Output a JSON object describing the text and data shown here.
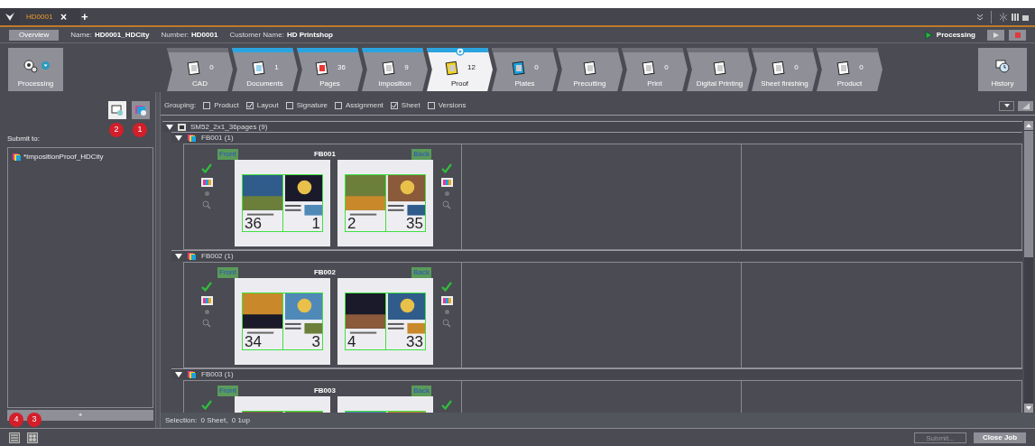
{
  "tabs": [
    {
      "label": "HD0001",
      "selected": true
    }
  ],
  "tab_close": "×",
  "new_tab": "+",
  "info": {
    "overview": "Overview",
    "fields": [
      {
        "label": "Name:",
        "value": "HD0001_HDCity"
      },
      {
        "label": "Number:",
        "value": "HD0001"
      },
      {
        "label": "Customer Name:",
        "value": "HD Printshop"
      }
    ],
    "status": "Processing"
  },
  "processing_tool": "Processing",
  "workflow": [
    {
      "label": "CAD",
      "count": "0",
      "active": false,
      "selected": false
    },
    {
      "label": "Documents",
      "count": "1",
      "active": true,
      "selected": false
    },
    {
      "label": "Pages",
      "count": "36",
      "active": true,
      "selected": false
    },
    {
      "label": "Imposition",
      "count": "9",
      "active": true,
      "selected": false
    },
    {
      "label": "Proof",
      "count": "12",
      "active": true,
      "selected": true
    },
    {
      "label": "Plates",
      "count": "0",
      "active": false,
      "selected": false
    },
    {
      "label": "Precutting",
      "active": false,
      "selected": false
    },
    {
      "label": "Print",
      "count": "0",
      "active": false,
      "selected": false
    },
    {
      "label": "Digital Printing",
      "active": false,
      "selected": false
    },
    {
      "label": "Sheet finishing",
      "count": "0",
      "active": false,
      "selected": false
    },
    {
      "label": "Product",
      "count": "0",
      "active": false,
      "selected": false
    }
  ],
  "history": "History",
  "left": {
    "badges": [
      "2",
      "1"
    ],
    "submit_label": "Submit to:",
    "targets": [
      "*ImpositionProof_HDCity"
    ],
    "add": "+",
    "bottom_badges": [
      "4",
      "3"
    ]
  },
  "grouping": {
    "label": "Grouping:",
    "options": [
      {
        "label": "Product",
        "checked": false
      },
      {
        "label": "Layout",
        "checked": true
      },
      {
        "label": "Signature",
        "checked": false
      },
      {
        "label": "Assignment",
        "checked": false
      },
      {
        "label": "Sheet",
        "checked": true
      },
      {
        "label": "Versions",
        "checked": false
      }
    ]
  },
  "tree": {
    "label": "SM52_2x1_36pages (9)",
    "expanded": true,
    "children": [
      {
        "label": "FB001 (1)",
        "expanded": true,
        "sheet": "FB001",
        "front": "Front",
        "back": "Back",
        "front_pages": [
          "36",
          "1"
        ],
        "back_pages": [
          "2",
          "35"
        ]
      },
      {
        "label": "FB002 (1)",
        "expanded": true,
        "sheet": "FB002",
        "front": "Front",
        "back": "Back",
        "front_pages": [
          "34",
          "3"
        ],
        "back_pages": [
          "4",
          "33"
        ]
      },
      {
        "label": "FB003 (1)",
        "expanded": true,
        "sheet": "FB003",
        "front": "Front",
        "back": "Back"
      }
    ]
  },
  "selection": "Selection:  0 Sheet,  0 1up",
  "buttons": [
    {
      "label": "Submit...",
      "disabled": true
    },
    {
      "label": "Close Job",
      "disabled": false
    }
  ]
}
